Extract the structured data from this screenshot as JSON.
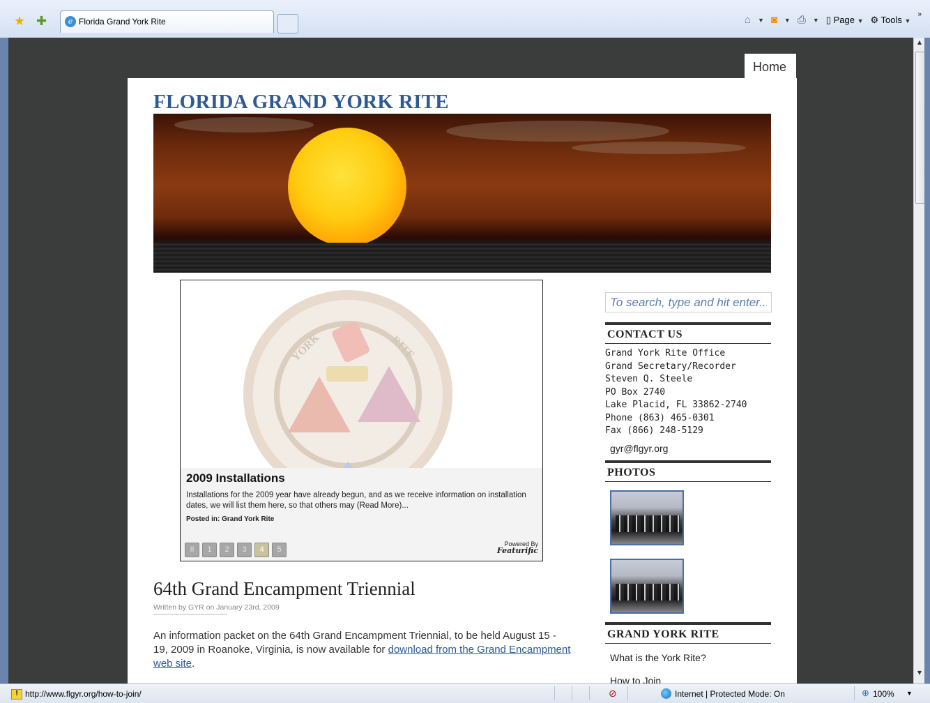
{
  "browser": {
    "tab_title": "Florida Grand York Rite",
    "toolbar": {
      "page_label": "Page",
      "tools_label": "Tools",
      "overflow": "»"
    },
    "status": {
      "url": "http://www.flgyr.org/how-to-join/",
      "zone": "Internet | Protected Mode: On",
      "zoom": "100%"
    }
  },
  "nav": {
    "home": "Home"
  },
  "site": {
    "title": "FLORIDA GRAND YORK RITE"
  },
  "slider": {
    "emblem_left": "YORK",
    "emblem_right": "RITE",
    "title": "2009 Installations",
    "text": "Installations for the 2009 year have already begun, and as we receive information on installation dates, we will list them here, so that others may (Read More)...",
    "posted_label": "Posted in:",
    "posted_value": "Grand York Rite",
    "pages": [
      "II",
      "1",
      "2",
      "3",
      "4",
      "5"
    ],
    "active_page": "4",
    "powered_line1": "Powered By",
    "powered_line2": "Featurific"
  },
  "post": {
    "title": "64th Grand Encampment Triennial",
    "meta": "Written by GYR on January 23rd, 2009",
    "body_text": "An information packet on the 64th Grand Encampment Triennial, to be held August 15 - 19, 2009 in Roanoke, Virginia, is now available for ",
    "link_text": "download from the Grand Encampment web site",
    "body_end": "."
  },
  "sidebar": {
    "search_placeholder": "To search, type and hit enter...",
    "contact_heading": "CONTACT US",
    "contact_lines": [
      "Grand York Rite Office",
      "Grand Secretary/Recorder",
      "Steven Q. Steele",
      "PO Box 2740",
      "Lake Placid, FL 33862-2740",
      "Phone (863) 465-0301",
      "Fax (866) 248-5129"
    ],
    "email": "gyr@flgyr.org",
    "photos_heading": "PHOTOS",
    "gyr_heading": "GRAND YORK RITE",
    "gyr_links": [
      "What is the York Rite?",
      "How to Join"
    ]
  },
  "colors": {
    "title_blue": "#2e5a94",
    "background": "#3a3d3c",
    "search_text": "#5a7fb0"
  }
}
